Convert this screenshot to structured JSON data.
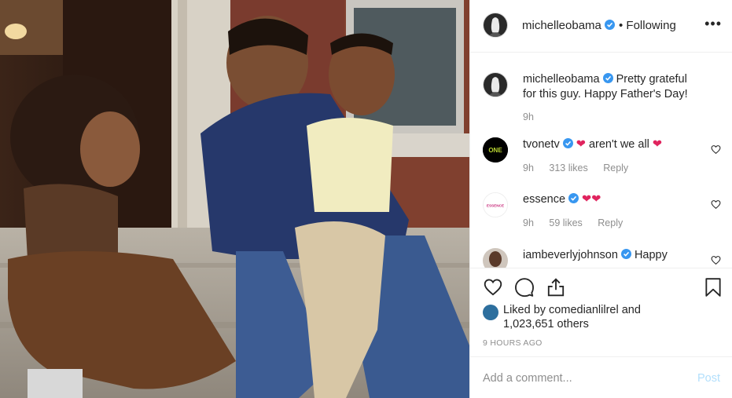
{
  "post": {
    "author": "michelleobama",
    "follow_state": "• Following",
    "more_glyph": "•••",
    "image_alt": "Family photo on front steps"
  },
  "comments": [
    {
      "username": "michelleobama",
      "text": "Pretty grateful for this guy. Happy Father's Day!",
      "time": "9h",
      "likes": "",
      "reply": "",
      "avatar": "michelleobama",
      "verified": true
    },
    {
      "username": "tvonetv",
      "text": " aren't we all ",
      "time": "9h",
      "likes": "313 likes",
      "reply": "Reply",
      "avatar_label": "ONE",
      "verified": true
    },
    {
      "username": "essence",
      "text": "",
      "time": "9h",
      "likes": "59 likes",
      "reply": "Reply",
      "avatar_label": "ESSENCE",
      "verified": true
    },
    {
      "username": "iambeverlyjohnson",
      "text": "Happy",
      "time": "",
      "likes": "",
      "reply": "",
      "verified": true
    }
  ],
  "likes": {
    "prefix": "Liked by ",
    "user": "comedianlilrel",
    "suffix": " and",
    "others": "1,023,651 others"
  },
  "timestamp": "9 HOURS AGO",
  "add_comment": {
    "placeholder": "Add a comment...",
    "post_label": "Post"
  },
  "colors": {
    "verified": "#3897f0",
    "heart": "#e0245e",
    "post_disabled": "#b2dffc",
    "muted": "#8e8e8e"
  },
  "icons": [
    "heart-icon",
    "comment-icon",
    "share-icon",
    "bookmark-icon",
    "verified-icon",
    "more-icon"
  ]
}
